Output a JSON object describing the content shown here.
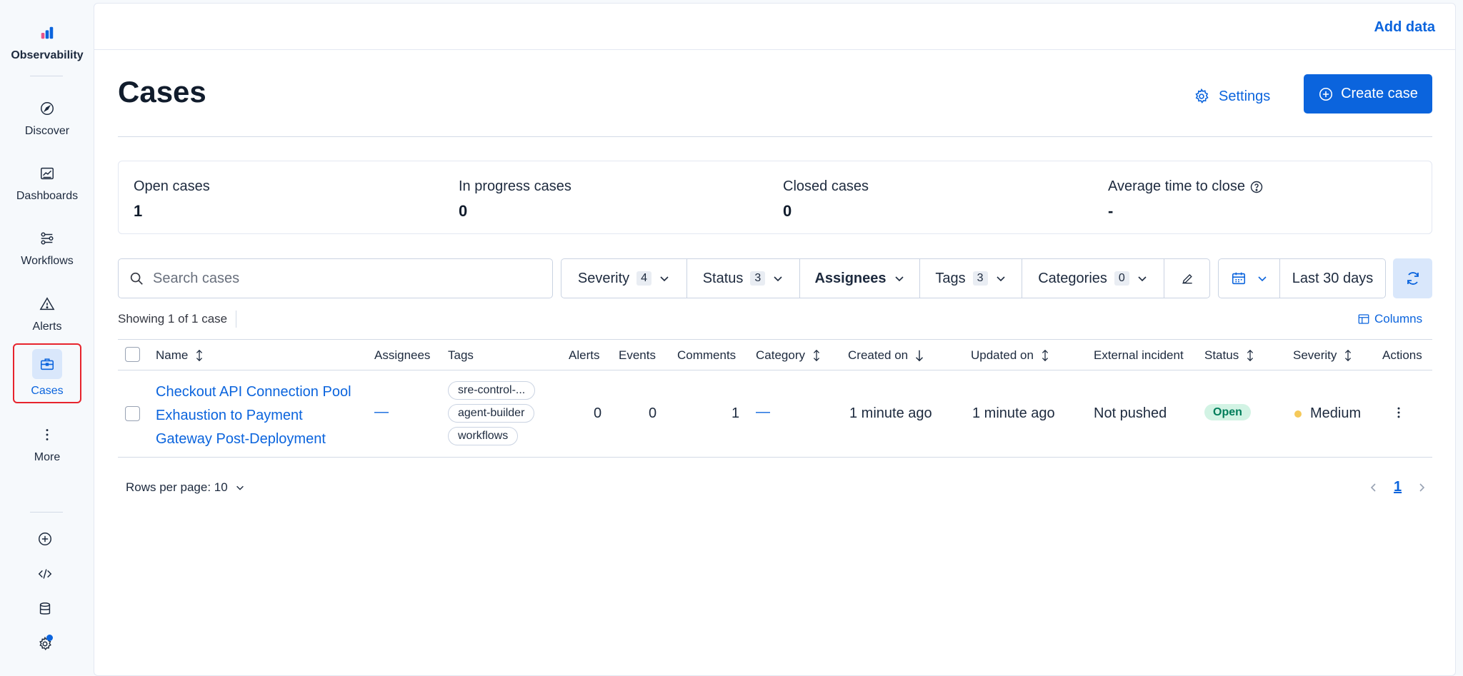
{
  "nav": {
    "logo_label": "Observability",
    "items": [
      {
        "label": "Discover",
        "icon": "compass-icon"
      },
      {
        "label": "Dashboards",
        "icon": "dashboard-icon"
      },
      {
        "label": "Workflows",
        "icon": "workflow-icon"
      },
      {
        "label": "Alerts",
        "icon": "warning-icon"
      },
      {
        "label": "Cases",
        "icon": "briefcase-icon",
        "active": true
      },
      {
        "label": "More",
        "icon": "more-vertical-icon"
      }
    ],
    "utilities": [
      "plus-circle-icon",
      "code-icon",
      "database-icon",
      "gear-icon"
    ]
  },
  "topbar": {
    "add_data": "Add data"
  },
  "page": {
    "title": "Cases",
    "settings_label": "Settings",
    "create_label": "Create case"
  },
  "stats": [
    {
      "label": "Open cases",
      "value": "1"
    },
    {
      "label": "In progress cases",
      "value": "0"
    },
    {
      "label": "Closed cases",
      "value": "0"
    },
    {
      "label": "Average time to close",
      "value": "-"
    }
  ],
  "filters": {
    "search_placeholder": "Search cases",
    "severity": {
      "label": "Severity",
      "count": "4"
    },
    "status": {
      "label": "Status",
      "count": "3"
    },
    "assignees": {
      "label": "Assignees"
    },
    "tags": {
      "label": "Tags",
      "count": "3"
    },
    "categories": {
      "label": "Categories",
      "count": "0"
    },
    "date_range": "Last 30 days"
  },
  "results": {
    "showing": "Showing 1 of 1 case",
    "columns_label": "Columns"
  },
  "table": {
    "headers": {
      "name": "Name",
      "assignees": "Assignees",
      "tags": "Tags",
      "alerts": "Alerts",
      "events": "Events",
      "comments": "Comments",
      "category": "Category",
      "created_on": "Created on",
      "updated_on": "Updated on",
      "external_incident": "External incident",
      "status": "Status",
      "severity": "Severity",
      "actions": "Actions"
    },
    "rows": [
      {
        "name": "Checkout API Connection Pool Exhaustion to Payment Gateway Post-Deployment",
        "assignees": "—",
        "tags": [
          "sre-control-...",
          "agent-builder",
          "workflows"
        ],
        "alerts": "0",
        "events": "0",
        "comments": "1",
        "category": "—",
        "created_on": "1 minute ago",
        "updated_on": "1 minute ago",
        "external_incident": "Not pushed",
        "status": "Open",
        "severity": "Medium"
      }
    ]
  },
  "pagination": {
    "rows_per_page": "Rows per page: 10",
    "current_page": "1"
  },
  "colors": {
    "primary": "#0b64dd",
    "active_nav_border": "#e7242d",
    "open_badge_bg": "#d2f3e4",
    "open_badge_text": "#007d5a",
    "severity_medium": "#f5c95a"
  }
}
